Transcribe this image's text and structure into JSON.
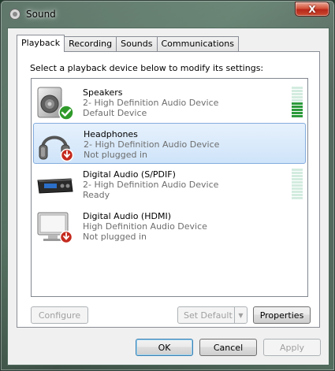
{
  "window": {
    "title": "Sound",
    "close_label": "X"
  },
  "tabs": [
    {
      "label": "Playback",
      "active": true
    },
    {
      "label": "Recording",
      "active": false
    },
    {
      "label": "Sounds",
      "active": false
    },
    {
      "label": "Communications",
      "active": false
    }
  ],
  "playback": {
    "instruction": "Select a playback device below to modify its settings:",
    "devices": [
      {
        "name": "Speakers",
        "line1": "2- High Definition Audio Device",
        "line2": "Default Device",
        "icon": "speaker-icon",
        "status": "default-check",
        "meter_level": 0.5
      },
      {
        "name": "Headphones",
        "line1": "2- High Definition Audio Device",
        "line2": "Not plugged in",
        "icon": "headphones-icon",
        "status": "unplugged",
        "selected": true
      },
      {
        "name": "Digital Audio (S/PDIF)",
        "line1": "2- High Definition Audio Device",
        "line2": "Ready",
        "icon": "digital-audio-icon",
        "status": "ready",
        "meter_level": 0
      },
      {
        "name": "Digital Audio (HDMI)",
        "line1": "High Definition Audio Device",
        "line2": "Not plugged in",
        "icon": "monitor-icon",
        "status": "unplugged"
      }
    ],
    "configure_label": "Configure",
    "set_default_label": "Set Default",
    "properties_label": "Properties"
  },
  "footer": {
    "ok_label": "OK",
    "cancel_label": "Cancel",
    "apply_label": "Apply"
  },
  "colors": {
    "selection": "#cfe4fa",
    "meter_on": "#2c9a3c",
    "meter_off": "#d3ece0"
  }
}
